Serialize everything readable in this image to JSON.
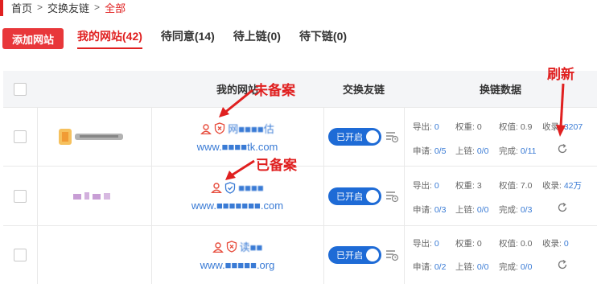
{
  "breadcrumb": {
    "home": "首页",
    "exchange": "交换友链",
    "current": "全部",
    "sep": ">"
  },
  "toolbar": {
    "add_label": "添加网站"
  },
  "tabs": [
    {
      "label": "我的网站(42)",
      "active": true
    },
    {
      "label": "待同意(14)",
      "active": false
    },
    {
      "label": "待上链(0)",
      "active": false
    },
    {
      "label": "待下链(0)",
      "active": false
    }
  ],
  "table": {
    "headers": {
      "site": "我的网站",
      "exchange": "交换友链",
      "stats": "换链数据"
    },
    "rows": [
      {
        "site_name": "网■■■■估",
        "site_url": "www.■■■■tk.com",
        "shield": "red-x",
        "toggle": "已开启",
        "out_label": "导出:",
        "out": "0",
        "w1_label": "权重:",
        "w1": "0",
        "w2_label": "权值:",
        "w2": "0.9",
        "inc_label": "收录:",
        "inc": "3207",
        "req_label": "申请:",
        "req": "0/5",
        "up_label": "上链:",
        "up": "0/0",
        "done_label": "完成:",
        "done": "0/11"
      },
      {
        "site_name": "■■■■",
        "site_url": "www.■■■■■■■.com",
        "shield": "blue-check",
        "toggle": "已开启",
        "out_label": "导出:",
        "out": "0",
        "w1_label": "权重:",
        "w1": "3",
        "w2_label": "权值:",
        "w2": "7.0",
        "inc_label": "收录:",
        "inc": "42万",
        "req_label": "申请:",
        "req": "0/3",
        "up_label": "上链:",
        "up": "0/0",
        "done_label": "完成:",
        "done": "0/3"
      },
      {
        "site_name": "读■■",
        "site_url": "www.■■■■■.org",
        "shield": "red-x",
        "toggle": "已开启",
        "out_label": "导出:",
        "out": "0",
        "w1_label": "权重:",
        "w1": "0",
        "w2_label": "权值:",
        "w2": "0.0",
        "inc_label": "收录:",
        "inc": "0",
        "req_label": "申请:",
        "req": "0/2",
        "up_label": "上链:",
        "up": "0/0",
        "done_label": "完成:",
        "done": "0/0"
      }
    ]
  },
  "annotations": {
    "no_record": "未备案",
    "recorded": "已备案",
    "refresh": "刷新"
  },
  "colors": {
    "accent": "#e02020",
    "link": "#3a7bd5",
    "toggle": "#1e6bd6"
  }
}
